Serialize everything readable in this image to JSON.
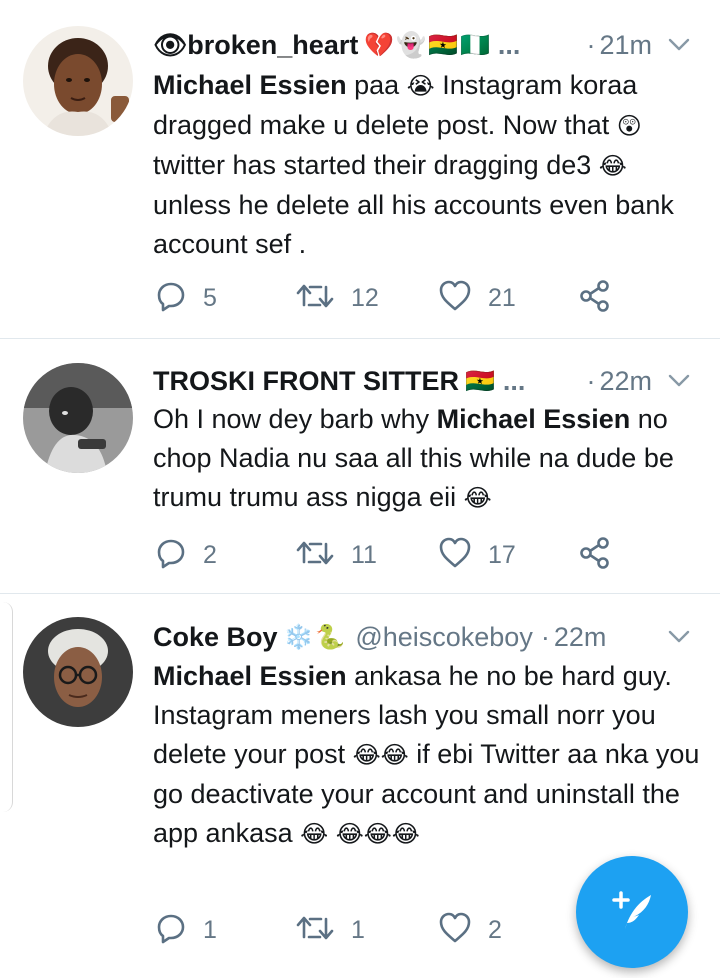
{
  "tweets": [
    {
      "display_name": "👁broken_heart",
      "name_emojis": "💔👻🇬🇭🇳🇬",
      "ellipsis": "...",
      "handle": "",
      "separator": "·",
      "time": "21m",
      "body": [
        {
          "t": "Michael Essien",
          "bold": true
        },
        {
          "t": " paa "
        },
        {
          "t": "😭",
          "emoji": true
        },
        {
          "t": " Instagram koraa dragged make u  delete  post. Now that "
        },
        {
          "t": "😲",
          "emoji": true
        },
        {
          "t": " twitter has started their dragging de3 "
        },
        {
          "t": "😂",
          "emoji": true
        },
        {
          "t": " unless he delete all  his accounts even bank account sef ."
        }
      ],
      "replies": "5",
      "retweets": "12",
      "likes": "21"
    },
    {
      "display_name": "TROSKI FRONT SITTER",
      "name_emojis": "🇬🇭",
      "ellipsis": "...",
      "handle": "",
      "separator": "·",
      "time": "22m",
      "body": [
        {
          "t": "Oh I now dey barb why "
        },
        {
          "t": "Michael Essien",
          "bold": true
        },
        {
          "t": " no chop Nadia nu saa all this while na dude be trumu trumu ass nigga eii "
        },
        {
          "t": "😂",
          "emoji": true
        }
      ],
      "replies": "2",
      "retweets": "11",
      "likes": "17"
    },
    {
      "display_name": "Coke Boy",
      "name_emojis": "❄️🐍",
      "ellipsis": "",
      "handle": "@heiscokeboy",
      "separator": "·",
      "time": "22m",
      "body": [
        {
          "t": "Michael Essien",
          "bold": true
        },
        {
          "t": " ankasa he no be hard guy. Instagram meners lash you small norr you delete your post "
        },
        {
          "t": "😂😂",
          "emoji": true
        },
        {
          "t": " if ebi Twitter aa nka you go deactivate your account and uninstall the app ankasa "
        },
        {
          "t": "😂",
          "emoji": true
        },
        {
          "t": " "
        },
        {
          "t": "😂😂😂",
          "emoji": true
        }
      ],
      "replies": "1",
      "retweets": "1",
      "likes": "2"
    }
  ],
  "icons": {
    "reply": "reply-icon",
    "retweet": "retweet-icon",
    "like": "heart-icon",
    "share": "share-icon",
    "caret": "chevron-down-icon",
    "compose": "compose-tweet-icon"
  },
  "colors": {
    "accent": "#1da1f2",
    "secondary_text": "#657786",
    "icon": "#5b7083",
    "divider": "#e1e8ed"
  }
}
